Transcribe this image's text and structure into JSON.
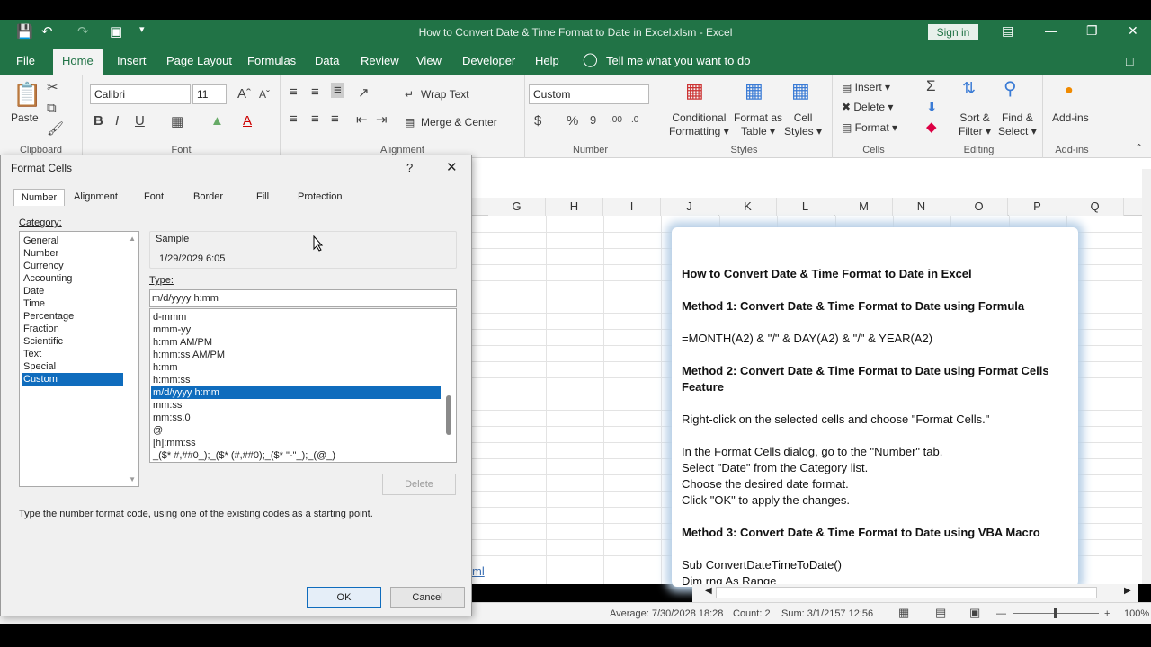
{
  "window": {
    "title": "How to Convert Date & Time Format to Date in Excel.xlsm  -  Excel",
    "sign_in": "Sign in"
  },
  "tabs": [
    "File",
    "Home",
    "Insert",
    "Page Layout",
    "Formulas",
    "Data",
    "Review",
    "View",
    "Developer",
    "Help"
  ],
  "tell_me": "Tell me what you want to do",
  "ribbon": {
    "clipboard": {
      "label": "Clipboard",
      "paste": "Paste"
    },
    "font": {
      "label": "Font",
      "name": "Calibri",
      "size": "11"
    },
    "alignment": {
      "label": "Alignment",
      "wrap": "Wrap Text",
      "merge": "Merge & Center"
    },
    "number": {
      "label": "Number",
      "format": "Custom"
    },
    "styles": {
      "label": "Styles",
      "cond": "Conditional",
      "cond2": "Formatting",
      "fmt_table": "Format as",
      "fmt_table2": "Table",
      "cell_styles": "Cell",
      "cell_styles2": "Styles"
    },
    "cells": {
      "label": "Cells",
      "insert": "Insert",
      "delete": "Delete",
      "format": "Format"
    },
    "editing": {
      "label": "Editing",
      "sort": "Sort &",
      "sort2": "Filter",
      "find": "Find &",
      "find2": "Select"
    },
    "addins": {
      "label": "Add-ins",
      "name": "Add-ins"
    }
  },
  "columns": [
    "G",
    "H",
    "I",
    "J",
    "K",
    "L",
    "M",
    "N",
    "O",
    "P",
    "Q"
  ],
  "note": {
    "title": "How to Convert Date & Time Format to Date in Excel",
    "m1": "Method 1: Convert Date & Time Format to Date using Formula",
    "formula": "=MONTH(A2) & \"/\" & DAY(A2) & \"/\" & YEAR(A2)",
    "m2a": "Method 2: Convert Date & Time Format to Date using Format Cells",
    "m2b": "Feature",
    "s1": "Right-click on the selected cells and choose \"Format Cells.\"",
    "s2": "In the Format Cells dialog, go to the \"Number\" tab.",
    "s3": "Select \"Date\" from the Category list.",
    "s4": "Choose the desired date format.",
    "s5": "Click \"OK\" to apply the changes.",
    "m3": "Method 3: Convert Date & Time Format to Date using VBA Macro",
    "code1": "Sub ConvertDateTimeToDate()",
    "code2": "    Dim rng As Range"
  },
  "status": {
    "average": "Average: 7/30/2028 18:28",
    "count": "Count: 2",
    "sum": "Sum: 3/1/2157 12:56",
    "zoom": "100%",
    "sheet_fragment": "ml"
  },
  "dialog": {
    "title": "Format Cells",
    "help": "?",
    "tabs": [
      "Number",
      "Alignment",
      "Font",
      "Border",
      "Fill",
      "Protection"
    ],
    "category_label": "Category:",
    "categories": [
      "General",
      "Number",
      "Currency",
      "Accounting",
      "Date",
      "Time",
      "Percentage",
      "Fraction",
      "Scientific",
      "Text",
      "Special",
      "Custom"
    ],
    "sample_label": "Sample",
    "sample_value": "1/29/2029 6:05",
    "type_label": "Type:",
    "type_value": "m/d/yyyy h:mm",
    "formats": [
      "d-mmm",
      "mmm-yy",
      "h:mm AM/PM",
      "h:mm:ss AM/PM",
      "h:mm",
      "h:mm:ss",
      "m/d/yyyy h:mm",
      "mm:ss",
      "mm:ss.0",
      "@",
      "[h]:mm:ss",
      "_($* #,##0_);_($* (#,##0);_($* \"-\"_);_(@_)"
    ],
    "delete": "Delete",
    "hint": "Type the number format code, using one of the existing codes as a starting point.",
    "ok": "OK",
    "cancel": "Cancel"
  }
}
